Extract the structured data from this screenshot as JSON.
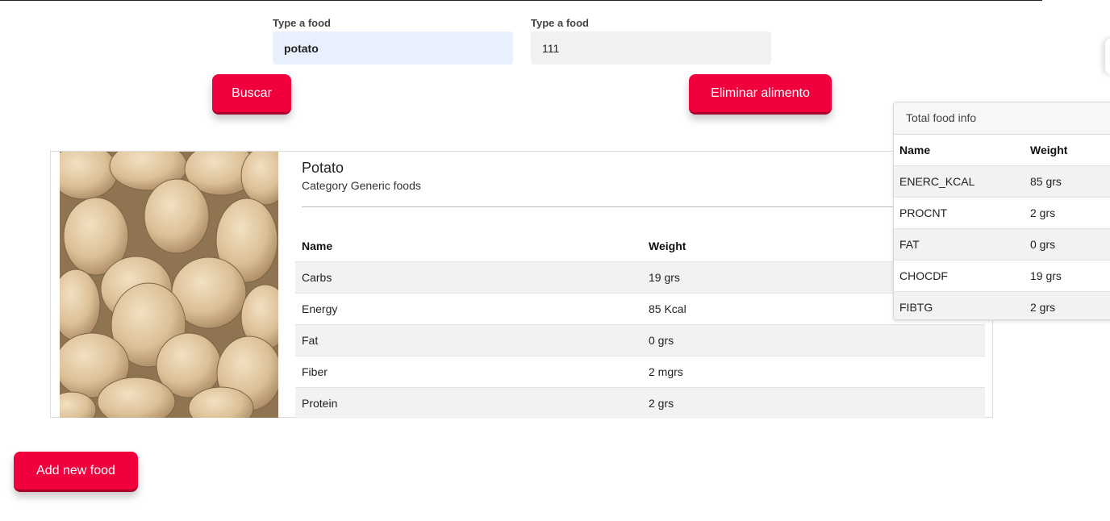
{
  "search": {
    "field1": {
      "label": "Type a food",
      "value": "potato"
    },
    "field2": {
      "label": "Type a food",
      "value": "111"
    },
    "search_button": "Buscar",
    "delete_button": "Eliminar alimento"
  },
  "food": {
    "title": "Potato",
    "category": "Category Generic foods",
    "image_icon": "potato-photo",
    "table": {
      "headers": [
        "Name",
        "Weight"
      ],
      "rows": [
        {
          "name": "Carbs",
          "weight": "19 grs"
        },
        {
          "name": "Energy",
          "weight": "85 Kcal"
        },
        {
          "name": "Fat",
          "weight": "0 grs"
        },
        {
          "name": "Fiber",
          "weight": "2 mgrs"
        },
        {
          "name": "Protein",
          "weight": "2 grs"
        }
      ]
    }
  },
  "total": {
    "title": "Total food info",
    "headers": [
      "Name",
      "Weight"
    ],
    "rows": [
      {
        "name": "ENERC_KCAL",
        "weight": "85 grs"
      },
      {
        "name": "PROCNT",
        "weight": "2 grs"
      },
      {
        "name": "FAT",
        "weight": "0 grs"
      },
      {
        "name": "CHOCDF",
        "weight": "19 grs"
      },
      {
        "name": "FIBTG",
        "weight": "2 grs"
      }
    ]
  },
  "add_button": "Add new food",
  "colors": {
    "accent": "#f0003c",
    "input_active": "#e8f0fd",
    "row_stripe": "#f2f2f2"
  }
}
